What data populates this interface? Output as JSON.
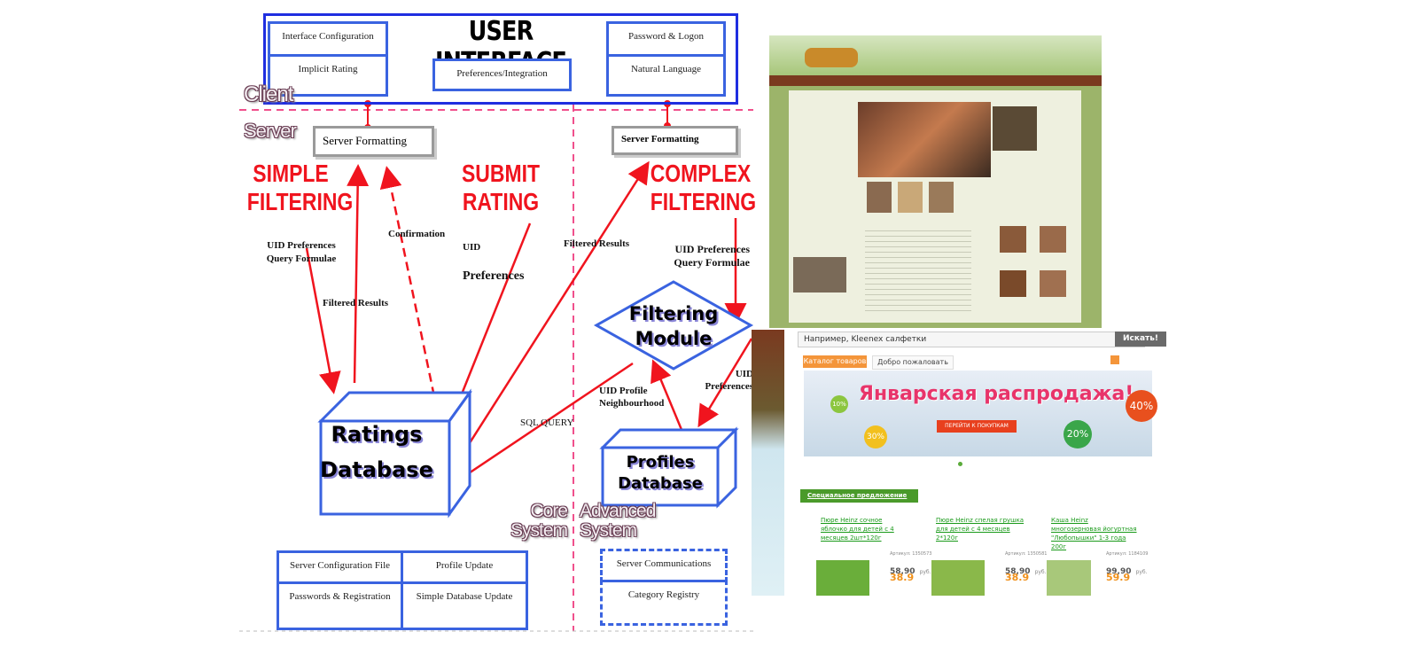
{
  "diagram": {
    "user_interface": {
      "title": "USER INTERFACE",
      "items": [
        "Interface Configuration",
        "Implicit Rating",
        "Preferences/Integration",
        "Password & Logon",
        "Natural Language"
      ]
    },
    "zones": {
      "client": "Client",
      "server": "Server",
      "core": "Core System",
      "advanced": "Advanced System"
    },
    "server_formatting_left": "Server Formatting",
    "server_formatting_right": "Server Formatting",
    "processes": {
      "simple_filtering": "SIMPLE FILTERING",
      "submit_rating": "SUBMIT RATING",
      "complex_filtering": "COMPLEX FILTERING"
    },
    "edge_labels": {
      "uid_prefs_query": "UID Preferences Query Formulae",
      "confirmation": "Confirmation",
      "uid": "UID",
      "preferences": "Preferences",
      "filtered_results_1": "Filtered Results",
      "filtered_results_2": "Filtered Results",
      "uid_prefs_query_2": "UID Preferences Query Formulae",
      "uid_profile": "UID Profile Neighbourhood",
      "sql_query": "SQL QUERY",
      "uid_prefs_2": "UID Preferences"
    },
    "filtering_module": "Filtering Module",
    "ratings_db": "Ratings Database",
    "profiles_db": "Profiles Database",
    "core_items": [
      "Server Configuration File",
      "Profile Update",
      "Passwords & Registration",
      "Simple Database Update"
    ],
    "advanced_items": [
      "Server Communications",
      "Category Registry"
    ],
    "colors": {
      "box_border": "#3a63e0",
      "arrow": "#f0141e",
      "divider": "#f0508c"
    }
  },
  "shop_screenshot": {
    "search_placeholder": "Например, Kleenex салфетки",
    "search_button": "Искать!",
    "tabs": [
      "Каталог товаров",
      "Добро пожаловать"
    ],
    "banner_title": "Январская распродажа!",
    "banner_button": "ПЕРЕЙТИ К ПОКУПКАМ",
    "discounts": [
      "10%",
      "30%",
      "20%",
      "40%"
    ],
    "special_offer": "Специальное предложение",
    "products": [
      {
        "name": "Пюре Heinz сочное яблочко для детей с 4 месяцев 2шт*120г",
        "article": "Артикул: 1350573",
        "old_price": "58,90",
        "price": "38.9",
        "currency": "руб."
      },
      {
        "name": "Пюре Heinz спелая грушка для детей с 4 месяцев 2*120г",
        "article": "Артикул: 1350581",
        "old_price": "58,90",
        "price": "38.9",
        "currency": "руб."
      },
      {
        "name": "Каша Heinz многозерновая йогуртная \"Любопышки\" 1-3 года 200г",
        "article": "Артикул: 1184109",
        "old_price": "99,90",
        "price": "59.9",
        "currency": "руб."
      }
    ]
  }
}
